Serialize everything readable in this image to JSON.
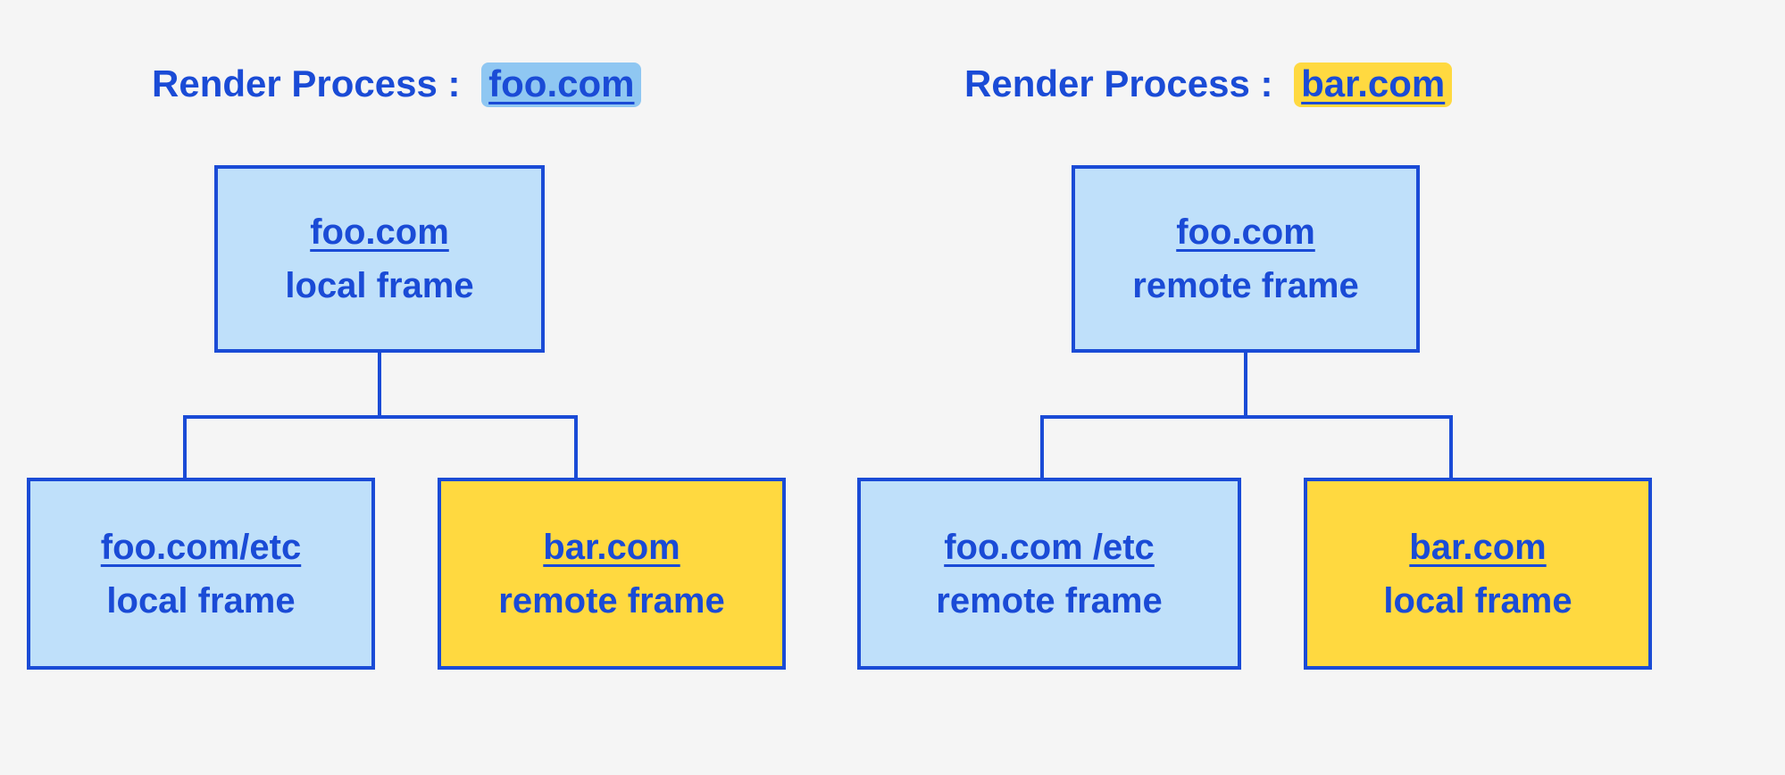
{
  "colors": {
    "stroke": "#1a4bd6",
    "text": "#1a4bd6",
    "blue_fill": "#bfe0fa",
    "yellow_fill": "#ffd940",
    "blue_hl": "#8fc7f2",
    "yellow_hl": "#ffd940",
    "page_bg": "#f5f5f5"
  },
  "left": {
    "title_prefix": "Render Process :",
    "title_site": "foo.com",
    "title_site_highlight": "blue",
    "root": {
      "url": "foo.com",
      "label": "local frame",
      "fill": "blue"
    },
    "children": [
      {
        "url": "foo.com/etc",
        "label": "local frame",
        "fill": "blue"
      },
      {
        "url": "bar.com",
        "label": "remote frame",
        "fill": "yellow"
      }
    ]
  },
  "right": {
    "title_prefix": "Render Process :",
    "title_site": "bar.com",
    "title_site_highlight": "yellow",
    "root": {
      "url": "foo.com",
      "label": "remote frame",
      "fill": "blue"
    },
    "children": [
      {
        "url": "foo.com /etc",
        "label": "remote frame",
        "fill": "blue"
      },
      {
        "url": "bar.com",
        "label": "local frame",
        "fill": "yellow"
      }
    ]
  }
}
